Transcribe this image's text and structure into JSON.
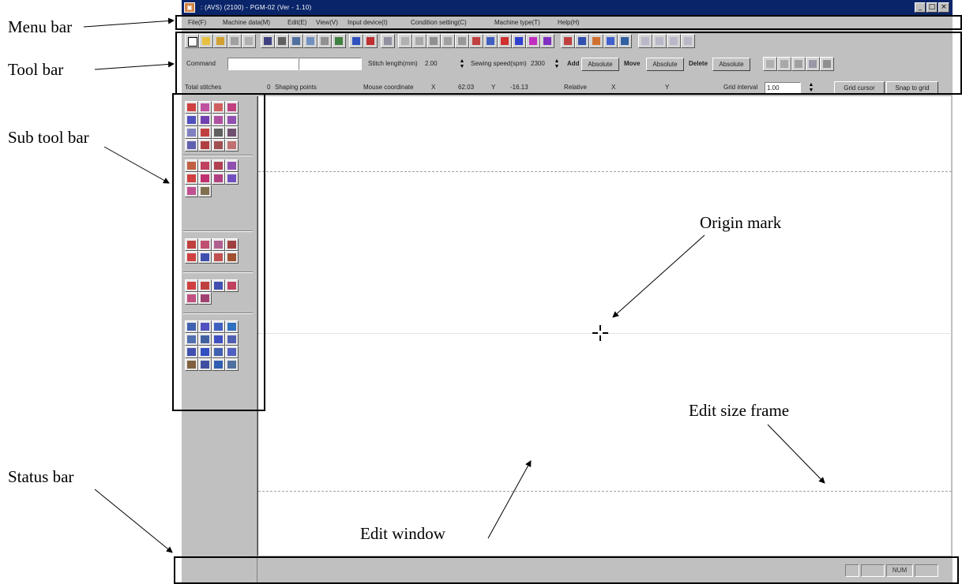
{
  "callouts": {
    "menu_bar": "Menu bar",
    "tool_bar": "Tool bar",
    "sub_tool_bar": "Sub tool  bar",
    "status_bar": "Status bar",
    "origin_mark": "Origin mark",
    "edit_size_frame": "Edit size frame",
    "edit_window": "Edit window"
  },
  "window": {
    "title": "  :  (AVS)  (2100)   -  PGM-02  (Ver - 1.10)",
    "controls": [
      "_",
      "□",
      "×"
    ]
  },
  "menu": [
    "File(F)",
    "Machine data(M)",
    "Edit(E)",
    "View(V)",
    "Input device(I)",
    "Condition setting(C)",
    "Machine type(T)",
    "Help(H)"
  ],
  "toolbar_row2": {
    "command_label": "Command",
    "stitch_length_label": "Stitch length(mm)",
    "stitch_length_value": "2.00",
    "sewing_speed_label": "Sewing speed(spm)",
    "sewing_speed_value": "2300",
    "add_label": "Add",
    "add_value": "Absolute",
    "move_label": "Move",
    "move_value": "Absolute",
    "delete_label": "Delete",
    "delete_value": "Absolute"
  },
  "toolbar_row3": {
    "total_stitches_label": "Total stitches",
    "total_stitches_value": "0",
    "shaping_points_label": "Shaping points",
    "mouse_coordinate_label": "Mouse coordinate",
    "x_label": "X",
    "x_value": "62.03",
    "y_label": "Y",
    "y_value": "-16.13",
    "relative_label": "Relative",
    "rel_x_label": "X",
    "rel_y_label": "Y",
    "grid_interval_label": "Grid interval",
    "grid_interval_value": "1.00",
    "grid_cursor_button": "Grid cursor",
    "snap_to_grid_button": "Snap to grid"
  },
  "status": {
    "num": "NUM"
  },
  "colors": {
    "titlebar": "#0a246a",
    "face": "#c0c0c0"
  }
}
